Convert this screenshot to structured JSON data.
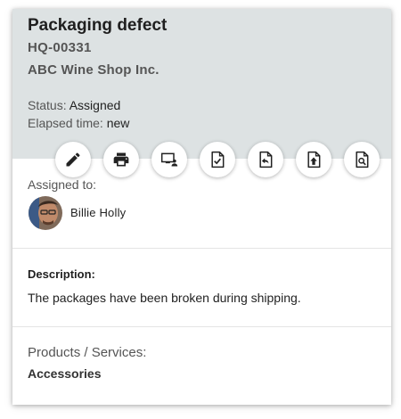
{
  "ticket": {
    "title": "Packaging defect",
    "id": "HQ-00331",
    "customer": "ABC Wine Shop Inc.",
    "status_label": "Status:",
    "status_value": "Assigned",
    "elapsed_label": "Elapsed time:",
    "elapsed_value": "new"
  },
  "actions": [
    {
      "name": "edit",
      "icon": "pencil-icon"
    },
    {
      "name": "print",
      "icon": "printer-icon"
    },
    {
      "name": "assign",
      "icon": "assign-monitor-icon"
    },
    {
      "name": "approve",
      "icon": "document-check-icon"
    },
    {
      "name": "reply",
      "icon": "document-reply-icon"
    },
    {
      "name": "upload",
      "icon": "document-upload-icon"
    },
    {
      "name": "preview",
      "icon": "document-search-icon"
    }
  ],
  "assignment": {
    "label": "Assigned to:",
    "assignee_name": "Billie Holly"
  },
  "description": {
    "label": "Description:",
    "text": "The packages have been broken during shipping."
  },
  "products": {
    "label": "Products / Services:",
    "value": "Accessories"
  },
  "colors": {
    "header_bg": "#dde2e3",
    "icon": "#222222"
  }
}
